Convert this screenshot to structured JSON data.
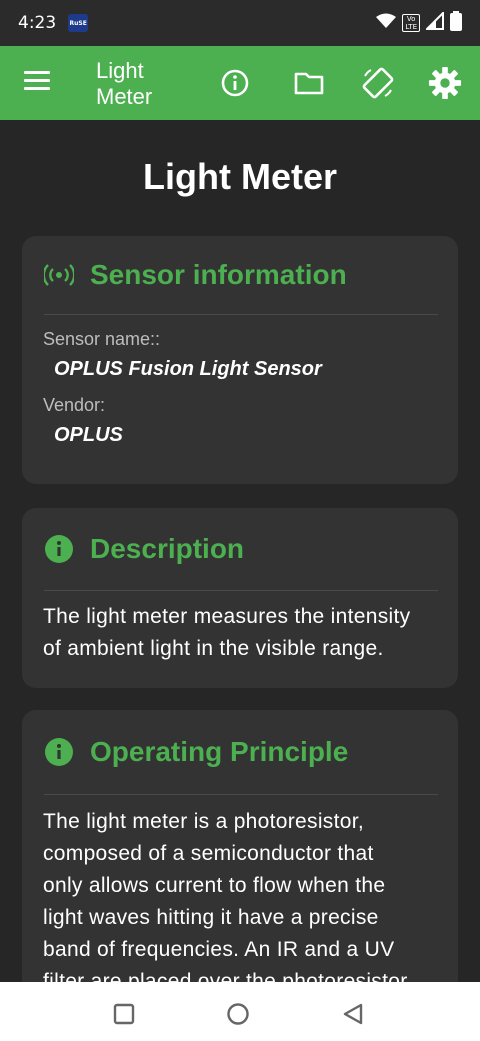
{
  "status_bar": {
    "time": "4:23",
    "app_badge": "RuSE",
    "volte": "Vo\nLTE",
    "icons": [
      "wifi-icon",
      "volte-icon",
      "signal-icon",
      "battery-icon"
    ]
  },
  "app_bar": {
    "title": "Light Meter",
    "icons": [
      "menu-icon",
      "info-icon",
      "folder-icon",
      "screen-rotation-icon",
      "settings-icon"
    ],
    "color": "#4caf50"
  },
  "page": {
    "title": "Light Meter"
  },
  "sensor_card": {
    "title": "Sensor information",
    "icon": "sensor-icon",
    "name_label": "Sensor name::",
    "name_value": "OPLUS Fusion Light Sensor",
    "vendor_label": "Vendor:",
    "vendor_value": "OPLUS"
  },
  "description_card": {
    "title": "Description",
    "icon": "info-icon",
    "lines": [
      "The light meter measures the intensity",
      "of ambient light in the visible range."
    ]
  },
  "principle_card": {
    "title": "Operating Principle",
    "icon": "info-icon",
    "lines": [
      "The light meter is a photoresistor,",
      "composed of a semiconductor that",
      "only allows current to flow when the",
      "light waves hitting it have a precise",
      "band of frequencies. An IR and a UV",
      "filter are placed over the photoresistor"
    ]
  },
  "nav_bar": {
    "buttons": [
      "recents-icon",
      "home-icon",
      "back-icon"
    ]
  },
  "colors": {
    "accent": "#4caf50",
    "background": "#262626",
    "card": "#333333"
  }
}
